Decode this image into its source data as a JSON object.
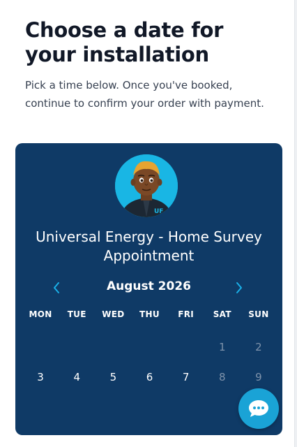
{
  "header": {
    "title": "Choose a date for your installation",
    "subtitle": "Pick a time below. Once you've booked, continue to confirm your order with payment."
  },
  "booking": {
    "appointment_title": "Universal Energy - Home Survey Appointment",
    "month_label": "August 2026",
    "weekdays": [
      "MON",
      "TUE",
      "WED",
      "THU",
      "FRI",
      "SAT",
      "SUN"
    ],
    "days": [
      {
        "label": "",
        "state": "empty"
      },
      {
        "label": "",
        "state": "empty"
      },
      {
        "label": "",
        "state": "empty"
      },
      {
        "label": "",
        "state": "empty"
      },
      {
        "label": "",
        "state": "empty"
      },
      {
        "label": "1",
        "state": "unavailable"
      },
      {
        "label": "2",
        "state": "unavailable"
      },
      {
        "label": "3",
        "state": "available"
      },
      {
        "label": "4",
        "state": "available"
      },
      {
        "label": "5",
        "state": "available"
      },
      {
        "label": "6",
        "state": "available"
      },
      {
        "label": "7",
        "state": "available"
      },
      {
        "label": "8",
        "state": "unavailable"
      },
      {
        "label": "9",
        "state": "unavailable"
      }
    ],
    "avatar_logo": "UF"
  },
  "icons": {
    "prev_month": "chevron-left-icon",
    "next_month": "chevron-right-icon",
    "chat": "chat-bubble-icon"
  },
  "colors": {
    "panel": "#0f3a66",
    "accent": "#1aa3d6",
    "muted_day": "#7f93ab"
  }
}
